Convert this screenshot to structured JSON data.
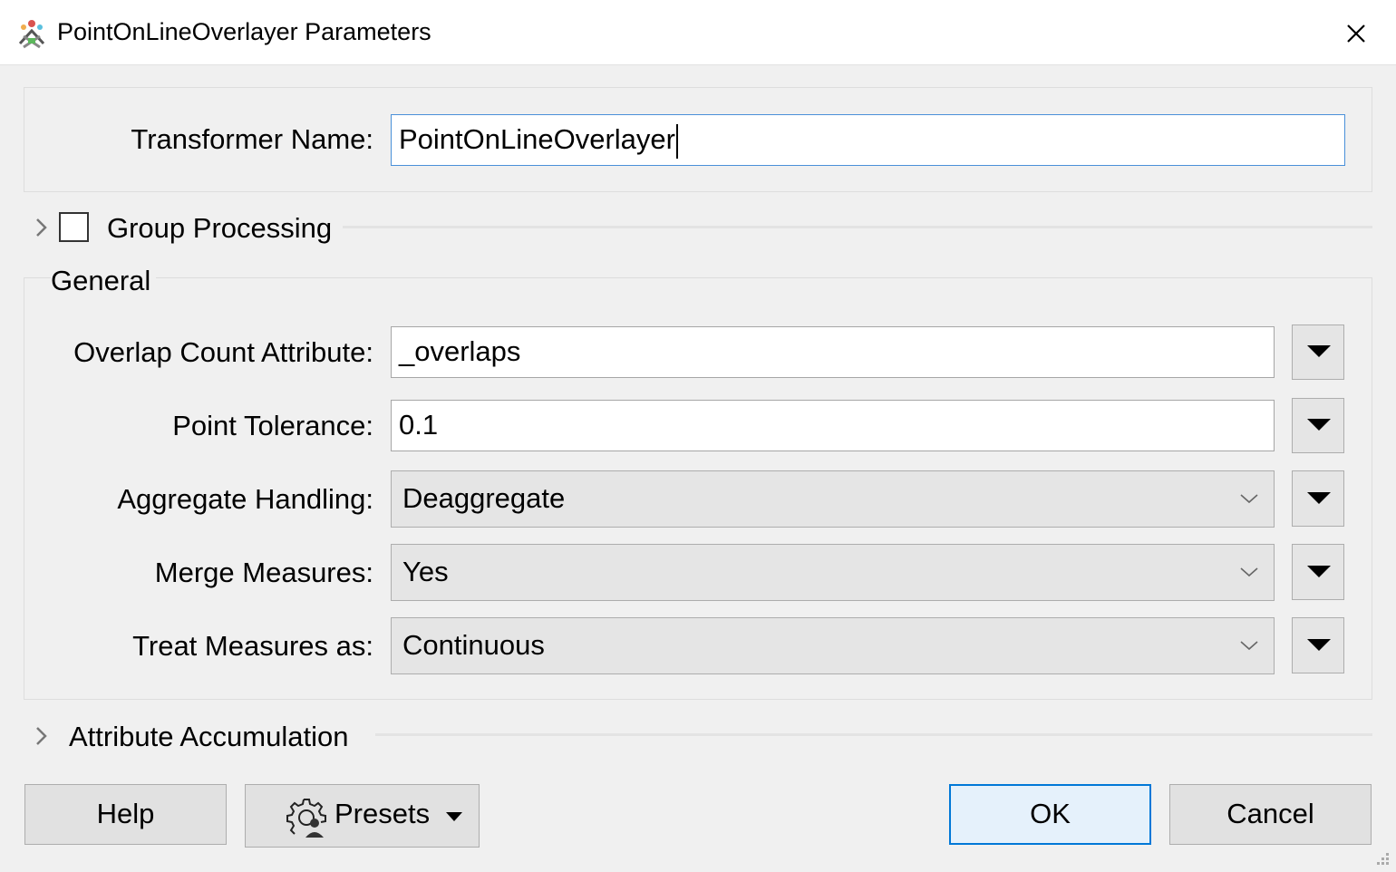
{
  "window": {
    "title": "PointOnLineOverlayer Parameters"
  },
  "icons": {
    "app": "fme-transformer-icon",
    "close": "close-icon",
    "expander": "chevron-right-icon",
    "dropdown": "chevron-down-icon",
    "menu": "triangle-down-icon",
    "presets": "gear-user-icon",
    "grip": "resize-grip-icon"
  },
  "transformer": {
    "label": "Transformer Name:",
    "value": "PointOnLineOverlayer"
  },
  "group_processing": {
    "label": "Group Processing",
    "checked": false
  },
  "general": {
    "title": "General",
    "overlap_count": {
      "label": "Overlap Count Attribute:",
      "value": "_overlaps"
    },
    "point_tolerance": {
      "label": "Point Tolerance:",
      "value": "0.1"
    },
    "aggregate_handling": {
      "label": "Aggregate Handling:",
      "value": "Deaggregate"
    },
    "merge_measures": {
      "label": "Merge Measures:",
      "value": "Yes"
    },
    "treat_measures": {
      "label": "Treat Measures as:",
      "value": "Continuous"
    }
  },
  "attribute_accumulation": {
    "label": "Attribute Accumulation"
  },
  "buttons": {
    "help": "Help",
    "presets": "Presets",
    "ok": "OK",
    "cancel": "Cancel"
  },
  "colors": {
    "accent": "#0078d7",
    "focus_border": "#4a90d9",
    "dialog_bg": "#f0f0f0"
  }
}
